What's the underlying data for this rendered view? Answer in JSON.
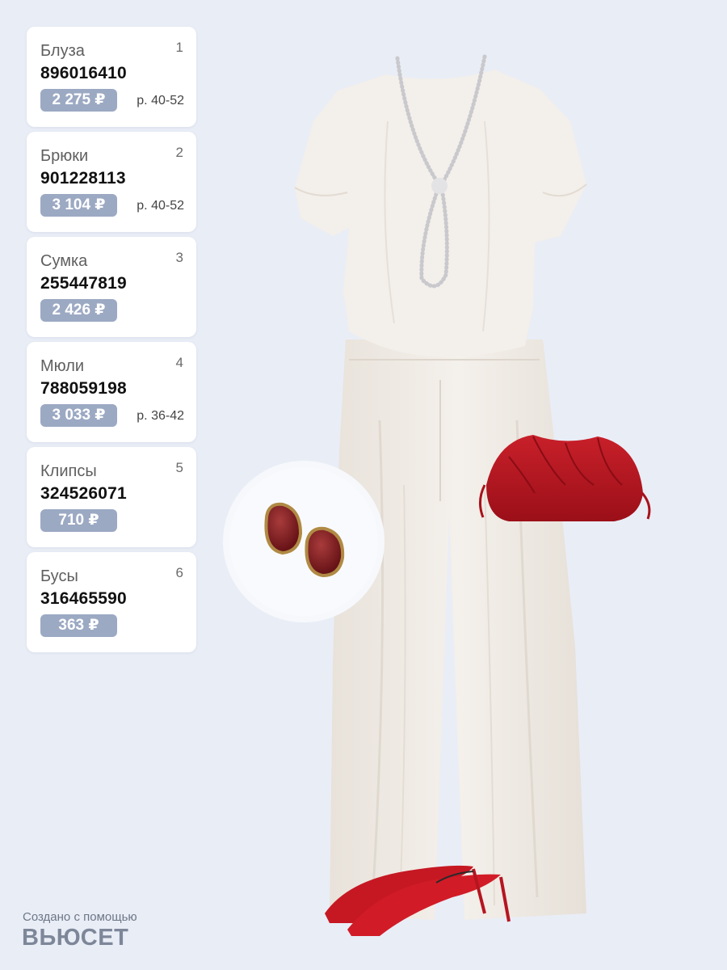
{
  "items": [
    {
      "name": "Блуза",
      "index": "1",
      "article": "896016410",
      "price": "2 275 ₽",
      "size": "р. 40-52"
    },
    {
      "name": "Брюки",
      "index": "2",
      "article": "901228113",
      "price": "3 104 ₽",
      "size": "р. 40-52"
    },
    {
      "name": "Сумка",
      "index": "3",
      "article": "255447819",
      "price": "2 426 ₽",
      "size": ""
    },
    {
      "name": "Мюли",
      "index": "4",
      "article": "788059198",
      "price": "3 033 ₽",
      "size": "р. 36-42"
    },
    {
      "name": "Клипсы",
      "index": "5",
      "article": "324526071",
      "price": "710 ₽",
      "size": ""
    },
    {
      "name": "Бусы",
      "index": "6",
      "article": "316465590",
      "price": "363 ₽",
      "size": ""
    }
  ],
  "footer": {
    "caption": "Создано с помощью",
    "logo": "ВЬЮСЕТ"
  },
  "colors": {
    "background": "#e9edf6",
    "price_badge": "#9ca9c3",
    "garment": "#f1ece6",
    "accessory_red": "#b3131c"
  },
  "images": [
    "blouse",
    "pearl-necklace",
    "trousers",
    "clutch-bag",
    "clip-earrings",
    "mules"
  ]
}
